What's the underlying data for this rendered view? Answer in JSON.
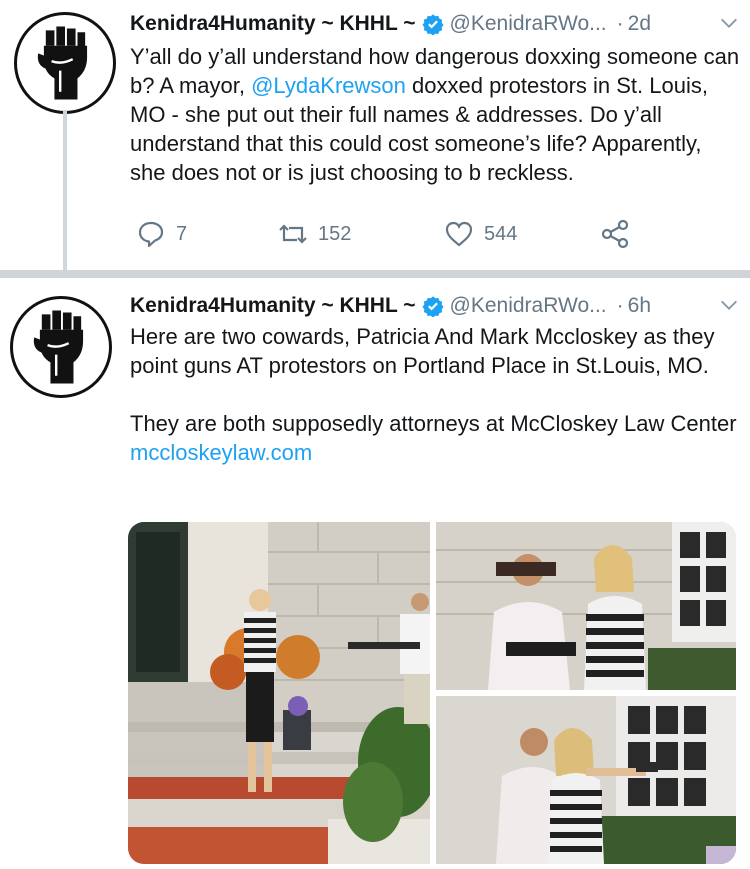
{
  "tweets": [
    {
      "author_name": "Kenidra4Humanity ~ KHHL ~",
      "handle": "@KenidraRWo...",
      "separator_dot": "·",
      "time": "2d",
      "text_before_mention": "Y’all do y’all understand how dangerous doxxing someone can b? A mayor, ",
      "mention": "@LydaKrewson",
      "text_after_mention": " doxxed protestors in St. Louis, MO - she put out their full names & addresses. Do y’all understand that this could cost someone’s life? Apparently, she does not or is just choosing to b reckless.",
      "reply_count": "7",
      "retweet_count": "152",
      "like_count": "544"
    },
    {
      "author_name": "Kenidra4Humanity ~ KHHL ~",
      "handle": "@KenidraRWo...",
      "separator_dot": "·",
      "time": "6h",
      "paragraph1": "Here are two cowards, Patricia And Mark Mccloskey as they point guns AT protestors on Portland Place in St.Louis, MO.",
      "paragraph2_text": "They are both supposedly attorneys at McCloskey Law Center ",
      "paragraph2_link": "mccloskeylaw.com"
    }
  ],
  "icons": {
    "avatar": "raised-fist-icon",
    "verified": "verified-badge-icon",
    "menu": "chevron-down-icon",
    "reply": "reply-icon",
    "retweet": "retweet-icon",
    "like": "heart-icon",
    "share": "share-icon"
  },
  "colors": {
    "link": "#1da1f2",
    "secondary_text": "#657786",
    "verified_badge": "#1da1f2",
    "separator": "#d0d4d8"
  }
}
